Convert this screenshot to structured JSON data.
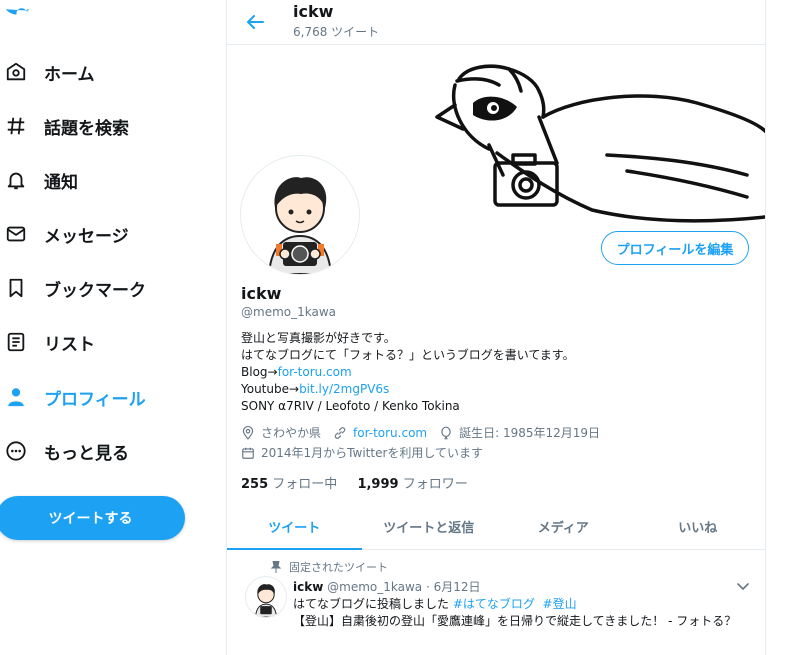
{
  "sidebar": {
    "items": [
      {
        "label": "ホーム",
        "icon": "home-icon"
      },
      {
        "label": "話題を検索",
        "icon": "hashtag-icon"
      },
      {
        "label": "通知",
        "icon": "bell-icon"
      },
      {
        "label": "メッセージ",
        "icon": "mail-icon"
      },
      {
        "label": "ブックマーク",
        "icon": "bookmark-icon"
      },
      {
        "label": "リスト",
        "icon": "list-icon"
      },
      {
        "label": "プロフィール",
        "icon": "person-icon"
      },
      {
        "label": "もっと見る",
        "icon": "more-icon"
      }
    ],
    "active_index": 6,
    "tweet_button": "ツイートする"
  },
  "header": {
    "name": "ickw",
    "tweet_count": "6,768 ツイート"
  },
  "profile": {
    "edit_button": "プロフィールを編集",
    "name": "ickw",
    "handle": "@memo_1kawa",
    "bio": {
      "line1": "登山と写真撮影が好きです。",
      "line2": "はてなブログにて「フォトる？」というブログを書いてます。",
      "line3_prefix": "Blog→",
      "line3_link": "for-toru.com",
      "line4_prefix": "Youtube→",
      "line4_link": "bit.ly/2mgPV6s",
      "line5": "SONY α7RIV  / Leofoto / Kenko Tokina"
    },
    "location": "さわやか県",
    "website": "for-toru.com",
    "birthday": "誕生日: 1985年12月19日",
    "joined": "2014年1月からTwitterを利用しています",
    "following_count": "255",
    "following_label": "フォロー中",
    "followers_count": "1,999",
    "followers_label": "フォロワー"
  },
  "tabs": [
    "ツイート",
    "ツイートと返信",
    "メディア",
    "いいね"
  ],
  "tweet": {
    "pinned_label": "固定されたツイート",
    "name": "ickw",
    "meta": "@memo_1kawa · 6月12日",
    "text_prefix": "はてなブログに投稿しました ",
    "hashtag1": "#はてなブログ",
    "hashtag2": "#登山",
    "text_line2": "【登山】自粛後初の登山「愛鷹連峰」を日帰りで縦走してきました！ - フォトる？"
  },
  "colors": {
    "accent": "#1da1f2",
    "text": "#14171a",
    "muted": "#657786",
    "border": "#e6ecf0"
  }
}
